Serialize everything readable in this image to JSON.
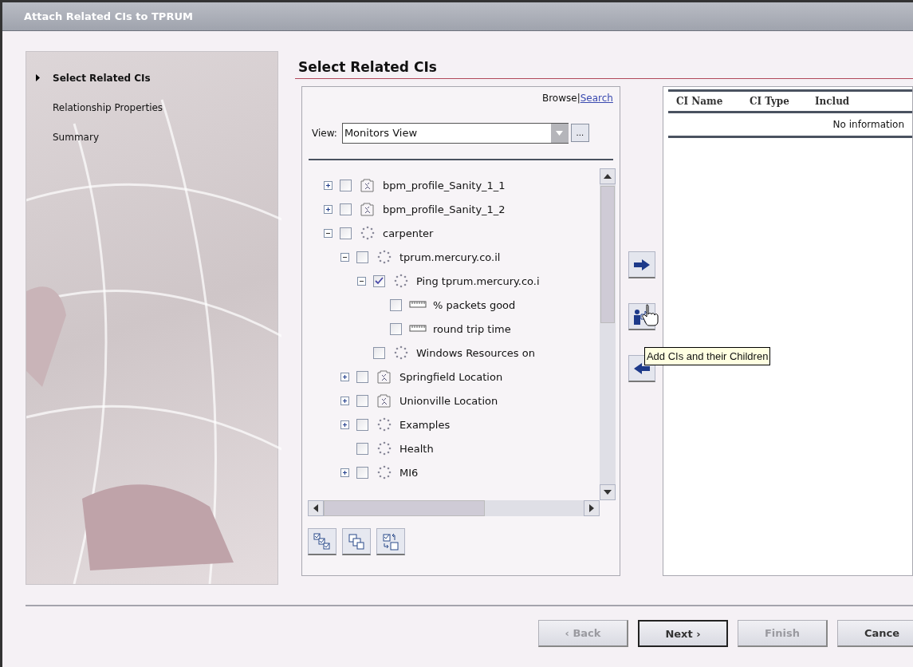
{
  "window": {
    "title": "Attach Related CIs to TPRUM"
  },
  "steps": [
    {
      "label": "Select Related CIs",
      "selected": true
    },
    {
      "label": "Relationship Properties",
      "selected": false
    },
    {
      "label": "Summary",
      "selected": false
    }
  ],
  "heading": "Select Related CIs",
  "browse_search": {
    "browse": "Browse",
    "separator": "|",
    "search": "Search"
  },
  "view": {
    "label": "View:",
    "value": "Monitors View",
    "more": "..."
  },
  "tree": [
    {
      "label": "bpm_profile_Sanity_1_1",
      "kind": "profile",
      "expanded": false,
      "checked": false
    },
    {
      "label": "bpm_profile_Sanity_1_2",
      "kind": "profile",
      "expanded": false,
      "checked": false
    },
    {
      "label": "carpenter",
      "kind": "group",
      "expanded": true,
      "checked": false,
      "children": [
        {
          "label": "tprum.mercury.co.il",
          "kind": "group",
          "expanded": true,
          "checked": false,
          "children": [
            {
              "label": "Ping tprum.mercury.co.i",
              "kind": "group",
              "expanded": true,
              "checked": true,
              "children": [
                {
                  "label": "% packets good",
                  "kind": "measurement",
                  "checked": false
                },
                {
                  "label": "round trip time",
                  "kind": "measurement",
                  "checked": false
                }
              ]
            },
            {
              "label": "Windows Resources on",
              "kind": "group",
              "checked": false
            }
          ]
        },
        {
          "label": "Springfield Location",
          "kind": "profile",
          "expanded": false,
          "checked": false
        },
        {
          "label": "Unionville Location",
          "kind": "profile",
          "expanded": false,
          "checked": false
        },
        {
          "label": "Examples",
          "kind": "group",
          "expanded": false,
          "checked": false
        },
        {
          "label": "Health",
          "kind": "group",
          "checked": false
        },
        {
          "label": "MI6",
          "kind": "group",
          "expanded": false,
          "checked": false
        }
      ]
    }
  ],
  "tooltip": "Add CIs and their Children",
  "table": {
    "columns": [
      "CI Name",
      "CI Type",
      "Includ"
    ],
    "empty": "No information"
  },
  "buttons": [
    {
      "label": "‹ Back",
      "disabled": true,
      "default": false
    },
    {
      "label": "Next ›",
      "disabled": false,
      "default": true
    },
    {
      "label": "Finish",
      "disabled": true,
      "default": false
    },
    {
      "label": "Cance",
      "disabled": false,
      "default": false
    }
  ]
}
